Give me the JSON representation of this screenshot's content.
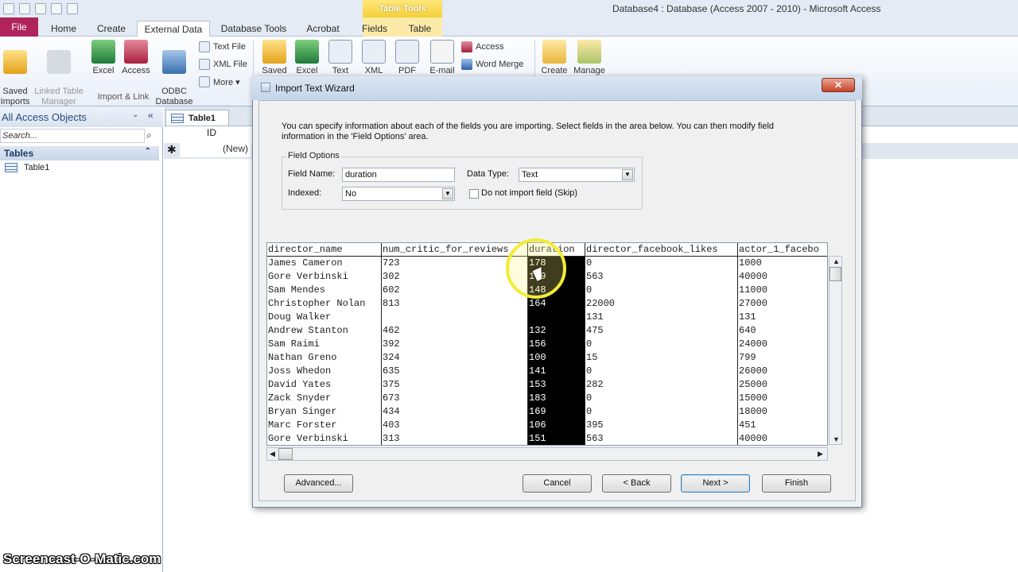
{
  "window": {
    "title": "Database4 : Database (Access 2007 - 2010)  -  Microsoft Access",
    "context_tab": "Table Tools"
  },
  "ribbon_tabs": [
    "File",
    "Home",
    "Create",
    "External Data",
    "Database Tools",
    "Acrobat",
    "Fields",
    "Table"
  ],
  "ribbon": {
    "import_link": {
      "saved_imports": "Saved\nImports",
      "linked_table_manager": "Linked Table\nManager",
      "excel": "Excel",
      "access": "Access",
      "odbc": "ODBC\nDatabase",
      "text_file": "Text File",
      "xml_file": "XML File",
      "more": "More ▾",
      "group_label": "Import & Link"
    },
    "export": {
      "saved": "Saved",
      "excel": "Excel",
      "text": "Text",
      "xml": "XML",
      "pdf": "PDF",
      "email": "E-mail",
      "access": "Access",
      "word_merge": "Word Merge",
      "create": "Create",
      "manage": "Manage"
    }
  },
  "nav": {
    "title": "All Access Objects",
    "search_placeholder": "Search...",
    "section": "Tables",
    "items": [
      "Table1"
    ]
  },
  "document": {
    "tab": "Table1",
    "id_header": "ID",
    "new_row": "(New)"
  },
  "dialog": {
    "title": "Import Text Wizard",
    "close": "✕",
    "instructions": "You can specify information about each of the fields you are importing. Select fields in the area below. You can then modify field information in the 'Field Options' area.",
    "field_options_label": "Field Options",
    "field_name_label": "Field Name:",
    "field_name_value": "duration",
    "data_type_label": "Data Type:",
    "data_type_value": "Text",
    "indexed_label": "Indexed:",
    "indexed_value": "No",
    "skip_label": "Do not import field (Skip)",
    "buttons": {
      "advanced": "Advanced...",
      "cancel": "Cancel",
      "back": "< Back",
      "next": "Next >",
      "finish": "Finish"
    }
  },
  "preview": {
    "columns": [
      "director_name",
      "num_critic_for_reviews",
      "duration",
      "director_facebook_likes",
      "actor_1_facebo"
    ],
    "selected_column": "duration",
    "rows": [
      [
        "James Cameron",
        "723",
        "178",
        "0",
        "1000"
      ],
      [
        "Gore Verbinski",
        "302",
        "169",
        "563",
        "40000"
      ],
      [
        "Sam Mendes",
        "602",
        "148",
        "0",
        "11000"
      ],
      [
        "Christopher Nolan",
        "813",
        "164",
        "22000",
        "27000"
      ],
      [
        "Doug Walker",
        "",
        "",
        "131",
        "131"
      ],
      [
        "Andrew Stanton",
        "462",
        "132",
        "475",
        "640"
      ],
      [
        "Sam Raimi",
        "392",
        "156",
        "0",
        "24000"
      ],
      [
        "Nathan Greno",
        "324",
        "100",
        "15",
        "799"
      ],
      [
        "Joss Whedon",
        "635",
        "141",
        "0",
        "26000"
      ],
      [
        "David Yates",
        "375",
        "153",
        "282",
        "25000"
      ],
      [
        "Zack Snyder",
        "673",
        "183",
        "0",
        "15000"
      ],
      [
        "Bryan Singer",
        "434",
        "169",
        "0",
        "18000"
      ],
      [
        "Marc Forster",
        "403",
        "106",
        "395",
        "451"
      ],
      [
        "Gore Verbinski",
        "313",
        "151",
        "563",
        "40000"
      ]
    ]
  },
  "watermark": "Screencast-O-Matic.com",
  "colors": {
    "file_tab": "#b0245c",
    "context_tab": "#f5cf3a",
    "selection": "#000000"
  }
}
